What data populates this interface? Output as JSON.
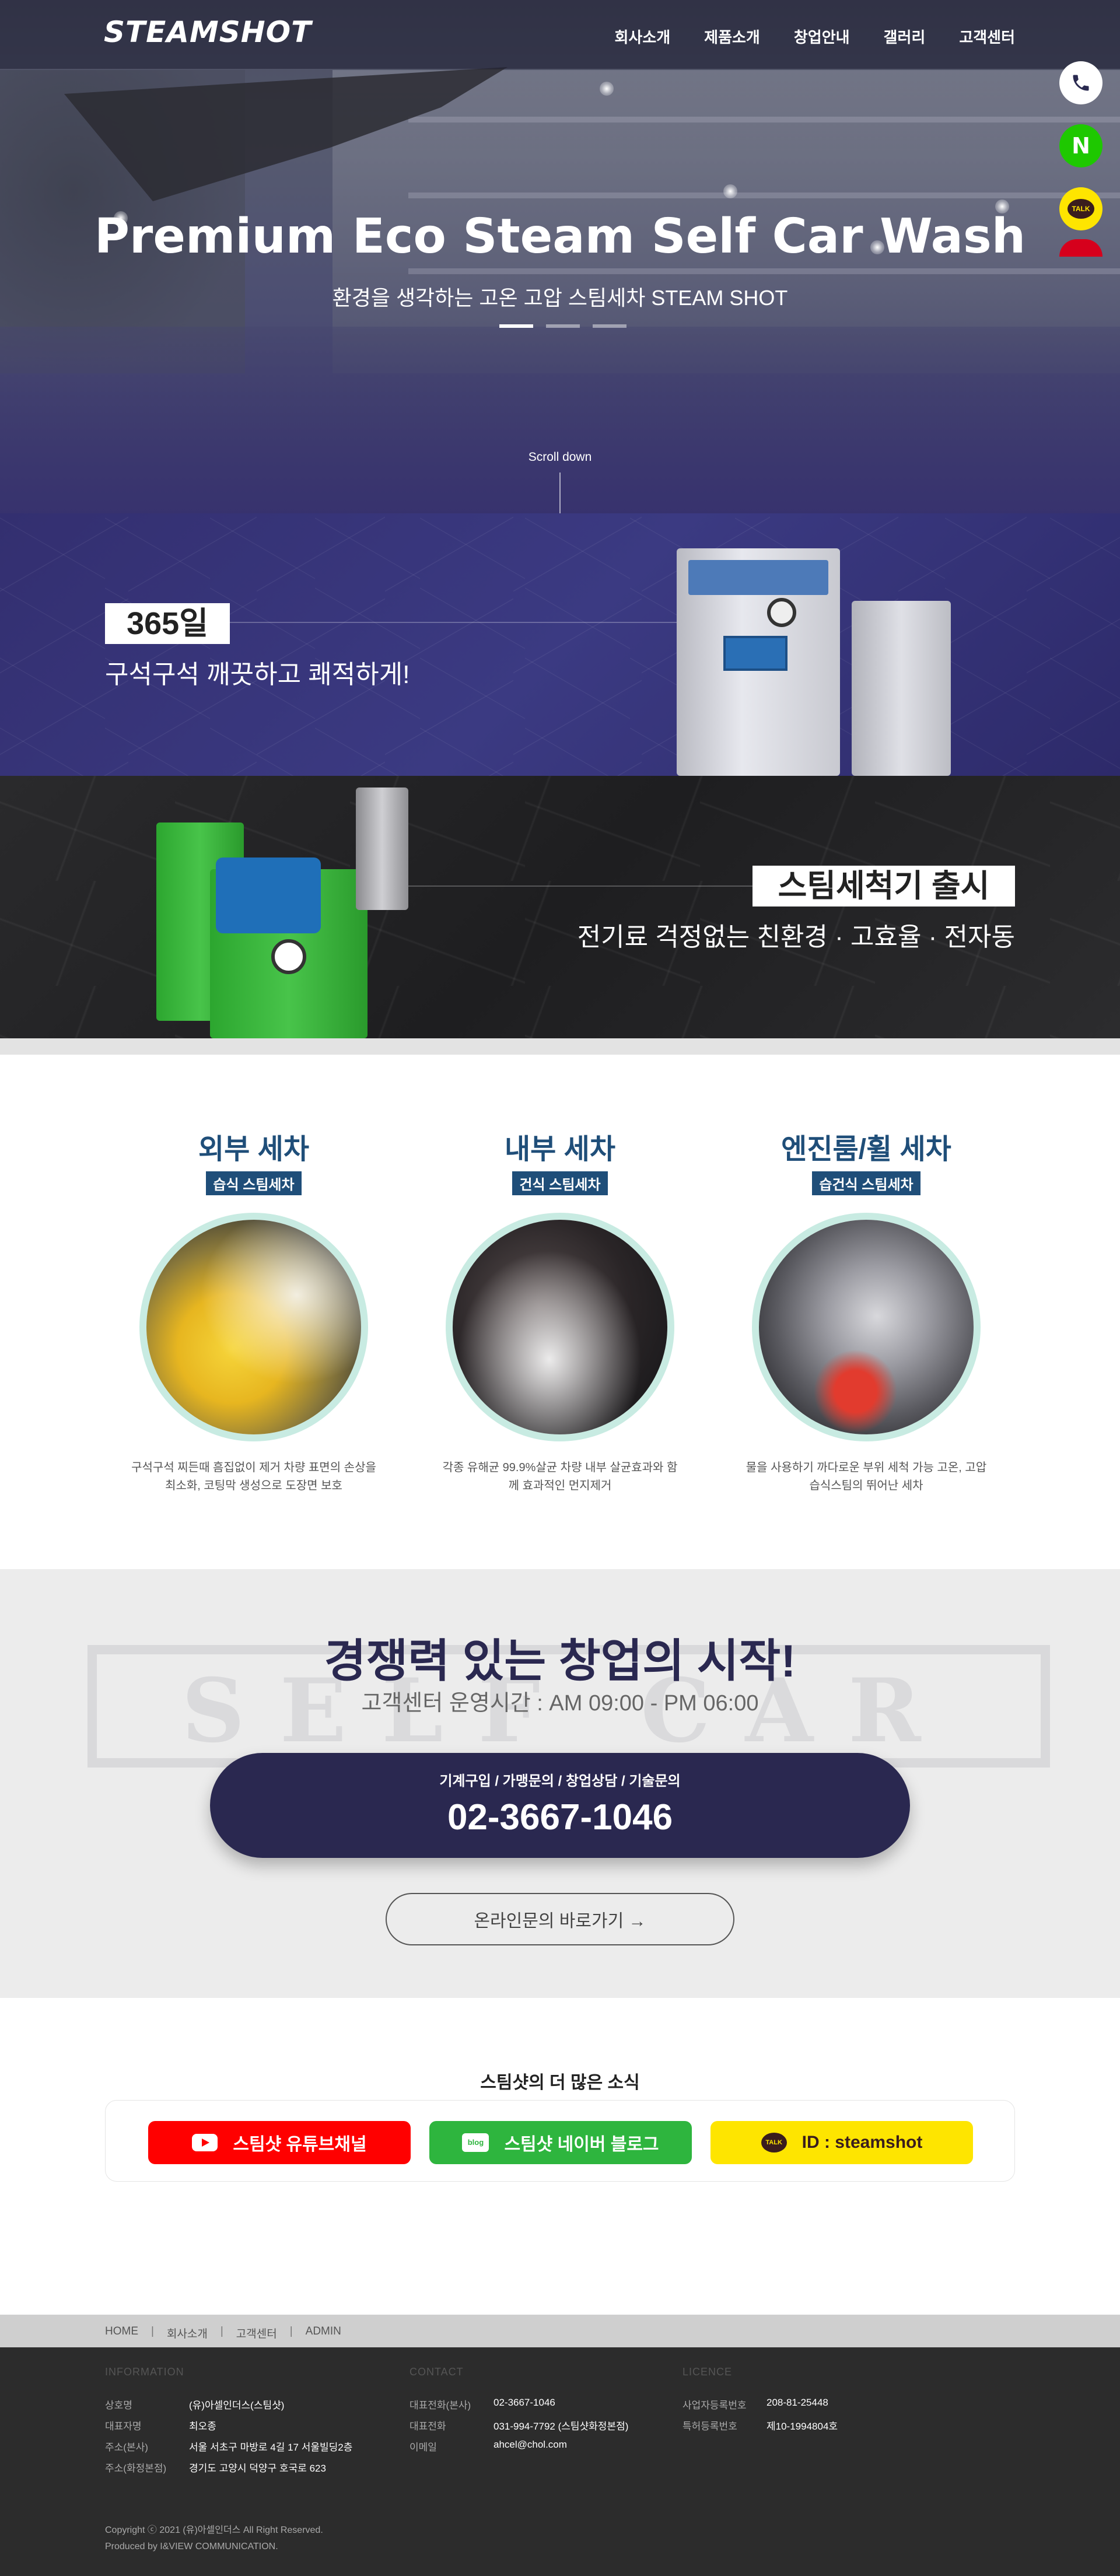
{
  "header": {
    "logo": "STEAMSHOT",
    "nav": [
      "회사소개",
      "제품소개",
      "창업안내",
      "갤러리",
      "고객센터"
    ]
  },
  "hero": {
    "title": "Premium Eco Steam Self Car Wash",
    "subtitle": "환경을 생각하는 고온 고압 스팀세차 STEAM SHOT",
    "slides": 3,
    "active_slide": 1,
    "scroll": "Scroll down"
  },
  "quick_menu": {
    "phone_icon": "phone-icon",
    "naver_label": "N",
    "talk_label": "TALK"
  },
  "band1": {
    "tag": "365일",
    "subtitle": "구석구석 깨끗하고 쾌적하게!"
  },
  "band2": {
    "tag": "스팀세척기 출시",
    "subtitle": "전기료 걱정없는 친환경 · 고효율 · 전자동"
  },
  "services": [
    {
      "title": "외부 세차",
      "badge": "습식 스팀세차",
      "desc": "구석구석 찌든때 흠집없이 제거 차량 표면의 손상을 최소화, 코팅막 생성으로 도장면 보호"
    },
    {
      "title": "내부 세차",
      "badge": "건식 스팀세차",
      "desc": "각종 유해균 99.9%살균 차량 내부 살균효과와 함께 효과적인 먼지제거"
    },
    {
      "title": "엔진룸/휠 세차",
      "badge": "습건식 스팀세차",
      "desc": "물을 사용하기 까다로운 부위 세척 가능 고온, 고압 습식스팀의 뛰어난 세차"
    }
  ],
  "start": {
    "title": "경쟁력 있는 창업의 시작!",
    "hours": "고객센터 운영시간 : AM 09:00 - PM 06:00",
    "call_caption": "기계구입 / 가맹문의 / 창업상담 / 기술문의",
    "phone": "02-3667-1046",
    "online_button": "온라인문의 바로가기 →"
  },
  "news": {
    "title": "스팀샷의 더 많은 소식",
    "youtube": "스팀샷 유튜브채널",
    "blog": "스팀샷 네이버 블로그",
    "blog_icon": "blog",
    "kakao": "ID : steamshot",
    "kakao_icon": "TALK"
  },
  "footer_nav": [
    "HOME",
    "회사소개",
    "고객센터",
    "ADMIN"
  ],
  "footer": {
    "info_title": "INFORMATION",
    "info": [
      {
        "k": "상호명",
        "v": "(유)아셀인더스(스팀샷)"
      },
      {
        "k": "대표자명",
        "v": "최오종"
      },
      {
        "k": "주소(본사)",
        "v": "서울 서초구 마방로 4길 17 서울빌딩2층"
      },
      {
        "k": "주소(화정본점)",
        "v": "경기도 고양시 덕양구 호국로 623"
      }
    ],
    "contact_title": "CONTACT",
    "contact": [
      {
        "k": "대표전화(본사)",
        "v": "02-3667-1046"
      },
      {
        "k": "대표전화",
        "v": "031-994-7792 (스팀샷화정본점)"
      },
      {
        "k": "이메일",
        "v": "ahcel@chol.com"
      }
    ],
    "licence_title": "LICENCE",
    "licence": [
      {
        "k": "사업자등록번호",
        "v": "208-81-25448"
      },
      {
        "k": "특허등록번호",
        "v": "제10-1994804호"
      }
    ],
    "copyright": "Copyright ⓒ 2021 (유)아셀인더스 All Right Reserved.",
    "produced": "Produced by I&VIEW COMMUNICATION."
  }
}
